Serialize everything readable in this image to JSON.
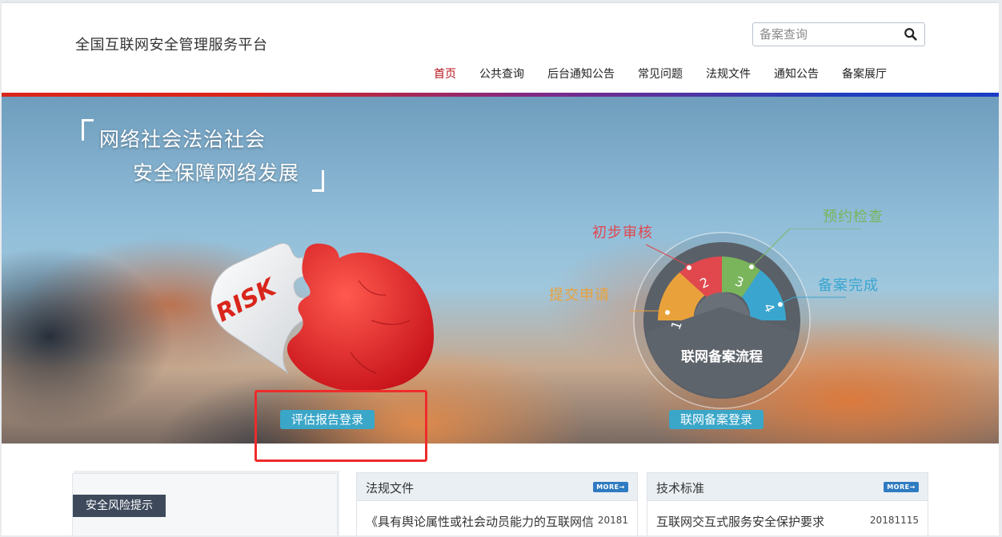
{
  "header": {
    "site_title": "全国互联网安全管理服务平台",
    "search_placeholder": "备案查询"
  },
  "nav": [
    {
      "label": "首页",
      "active": true
    },
    {
      "label": "公共查询"
    },
    {
      "label": "后台通知公告"
    },
    {
      "label": "常见问题"
    },
    {
      "label": "法规文件"
    },
    {
      "label": "通知公告"
    },
    {
      "label": "备案展厅"
    }
  ],
  "banner": {
    "slogan_line1": "网络社会法治社会",
    "slogan_line2": "安全保障网络发展",
    "puzzle_text": "RISK",
    "process": {
      "title": "联网备案流程",
      "steps": [
        {
          "num": "1",
          "label": "提交申请",
          "color": "#e9a23b"
        },
        {
          "num": "2",
          "label": "初步审核",
          "color": "#e0484e"
        },
        {
          "num": "3",
          "label": "预约检查",
          "color": "#7ab55c"
        },
        {
          "num": "4",
          "label": "备案完成",
          "color": "#3aa6d0"
        }
      ]
    },
    "btn_report": "评估报告登录",
    "btn_filing": "联网备案登录"
  },
  "sections": {
    "risk_tab": "安全风险提示",
    "laws": {
      "title": "法规文件",
      "more": "MORE",
      "item": "《具有舆论属性或社会动员能力的互联网信",
      "date": "20181"
    },
    "standards": {
      "title": "技术标准",
      "more": "MORE",
      "item": "互联网交互式服务安全保护要求",
      "date": "20181115"
    }
  },
  "colors": {
    "nav_active": "#b5121b",
    "button": "#3aa6c8",
    "highlight_box": "#ee2b2b"
  }
}
